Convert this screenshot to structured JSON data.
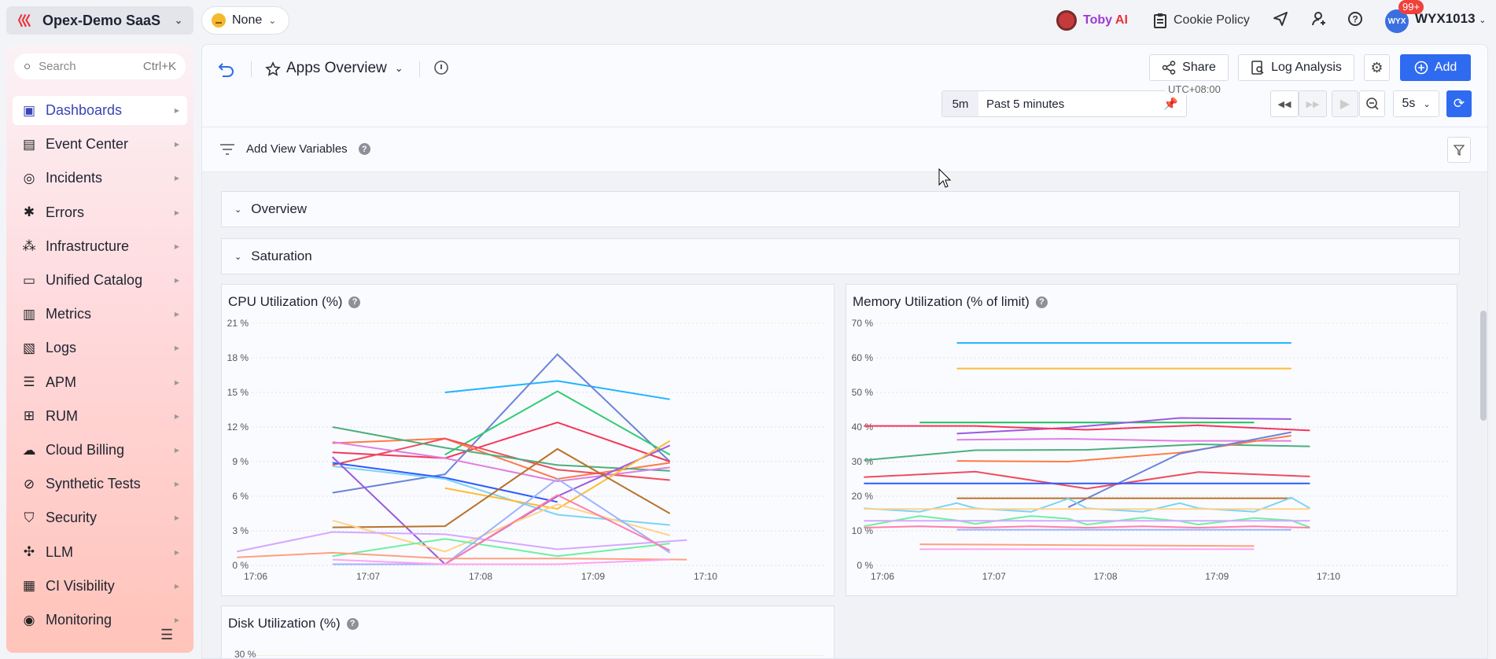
{
  "topbar": {
    "org": "Opex-Demo SaaS",
    "mood": "None",
    "toby_first": "Toby",
    "toby_second": "AI",
    "cookie": "Cookie Policy",
    "avatar": "WYX",
    "badge": "99+",
    "user": "WYX1013"
  },
  "sidebar": {
    "search_placeholder": "Search",
    "search_shortcut": "Ctrl+K",
    "items": [
      {
        "label": "Dashboards",
        "icon": "dashboard-icon"
      },
      {
        "label": "Event Center",
        "icon": "calendar-icon"
      },
      {
        "label": "Incidents",
        "icon": "incident-icon"
      },
      {
        "label": "Errors",
        "icon": "bug-icon"
      },
      {
        "label": "Infrastructure",
        "icon": "infrastructure-icon"
      },
      {
        "label": "Unified Catalog",
        "icon": "catalog-icon"
      },
      {
        "label": "Metrics",
        "icon": "metrics-icon"
      },
      {
        "label": "Logs",
        "icon": "logs-icon"
      },
      {
        "label": "APM",
        "icon": "apm-icon"
      },
      {
        "label": "RUM",
        "icon": "rum-icon"
      },
      {
        "label": "Cloud Billing",
        "icon": "cloud-billing-icon"
      },
      {
        "label": "Synthetic Tests",
        "icon": "synthetic-icon"
      },
      {
        "label": "Security",
        "icon": "shield-icon"
      },
      {
        "label": "LLM",
        "icon": "llm-icon"
      },
      {
        "label": "CI Visibility",
        "icon": "ci-icon"
      },
      {
        "label": "Monitoring",
        "icon": "monitoring-icon"
      }
    ]
  },
  "header": {
    "title": "Apps Overview",
    "share": "Share",
    "log_analysis": "Log Analysis",
    "add": "Add",
    "timezone": "UTC+08:00",
    "range_short": "5m",
    "range_label": "Past 5 minutes",
    "refresh_interval": "5s",
    "add_variables": "Add View Variables"
  },
  "sections": [
    "Overview",
    "Saturation"
  ],
  "colors": {
    "accent": "#2f6bf0",
    "active_nav": "#3a44b5"
  },
  "chart_data": [
    {
      "type": "line",
      "title": "CPU Utilization (%)",
      "yticks": [
        "0 %",
        "3 %",
        "6 %",
        "9 %",
        "12 %",
        "15 %",
        "18 %",
        "21 %"
      ],
      "ylim": [
        0,
        21
      ],
      "xticks": [
        "17:06",
        "17:07",
        "17:08",
        "17:09",
        "17:10"
      ],
      "xlim": [
        "17:06",
        "17:10"
      ],
      "grid": true,
      "series": [
        {
          "color": "#1eb4ff",
          "points": [
            [
              "17:07:41",
              15.0
            ],
            [
              "17:08:41",
              16.0
            ],
            [
              "17:09:41",
              14.4
            ]
          ]
        },
        {
          "color": "#6b84d9",
          "points": [
            [
              "17:06:41",
              6.3
            ],
            [
              "17:07:41",
              7.9
            ],
            [
              "17:08:41",
              18.3
            ],
            [
              "17:09:41",
              9.0
            ]
          ]
        },
        {
          "color": "#2ecc71",
          "points": [
            [
              "17:07:41",
              9.6
            ],
            [
              "17:08:41",
              15.1
            ],
            [
              "17:09:41",
              9.6
            ]
          ]
        },
        {
          "color": "#f5365c",
          "points": [
            [
              "17:06:41",
              9.8
            ],
            [
              "17:07:41",
              9.3
            ],
            [
              "17:08:41",
              12.4
            ],
            [
              "17:09:41",
              9.0
            ]
          ]
        },
        {
          "color": "#ff7a45",
          "points": [
            [
              "17:06:41",
              10.6
            ],
            [
              "17:07:41",
              11.0
            ],
            [
              "17:08:41",
              7.5
            ],
            [
              "17:09:41",
              8.9
            ]
          ]
        },
        {
          "color": "#ef4d5a",
          "points": [
            [
              "17:06:41",
              8.7
            ],
            [
              "17:07:41",
              11.0
            ],
            [
              "17:08:41",
              8.3
            ],
            [
              "17:09:41",
              7.4
            ]
          ]
        },
        {
          "color": "#4caf7d",
          "points": [
            [
              "17:06:41",
              12.0
            ],
            [
              "17:07:41",
              10.2
            ],
            [
              "17:08:41",
              8.7
            ],
            [
              "17:09:41",
              8.2
            ]
          ]
        },
        {
          "color": "#e07ee0",
          "points": [
            [
              "17:06:41",
              10.7
            ],
            [
              "17:07:41",
              9.3
            ],
            [
              "17:08:41",
              7.3
            ],
            [
              "17:09:41",
              8.5
            ]
          ]
        },
        {
          "color": "#2d5bff",
          "points": [
            [
              "17:06:41",
              8.9
            ],
            [
              "17:07:41",
              7.6
            ],
            [
              "17:08:41",
              5.5
            ]
          ]
        },
        {
          "color": "#7dd3f5",
          "points": [
            [
              "17:06:41",
              8.6
            ],
            [
              "17:07:41",
              7.5
            ],
            [
              "17:08:41",
              4.4
            ],
            [
              "17:09:41",
              3.5
            ]
          ]
        },
        {
          "color": "#9b59e0",
          "points": [
            [
              "17:06:41",
              9.4
            ],
            [
              "17:07:41",
              0.1
            ],
            [
              "17:08:41",
              6.0
            ],
            [
              "17:09:41",
              10.4
            ]
          ]
        },
        {
          "color": "#ffbb33",
          "points": [
            [
              "17:07:41",
              6.7
            ],
            [
              "17:08:41",
              4.9
            ],
            [
              "17:09:41",
              10.8
            ]
          ]
        },
        {
          "color": "#b8732a",
          "points": [
            [
              "17:06:41",
              3.3
            ],
            [
              "17:07:41",
              3.4
            ],
            [
              "17:08:41",
              10.1
            ],
            [
              "17:09:41",
              4.5
            ]
          ]
        },
        {
          "color": "#ffd38a",
          "points": [
            [
              "17:06:41",
              3.9
            ],
            [
              "17:07:41",
              1.2
            ],
            [
              "17:08:41",
              5.3
            ],
            [
              "17:09:41",
              2.6
            ]
          ]
        },
        {
          "color": "#d4a8ff",
          "points": [
            [
              "17:05:50",
              1.2
            ],
            [
              "17:06:41",
              2.9
            ],
            [
              "17:07:41",
              2.7
            ],
            [
              "17:08:41",
              1.4
            ],
            [
              "17:09:50",
              2.2
            ]
          ]
        },
        {
          "color": "#6ef0a0",
          "points": [
            [
              "17:06:41",
              0.8
            ],
            [
              "17:07:41",
              2.3
            ],
            [
              "17:08:41",
              0.8
            ],
            [
              "17:09:41",
              1.9
            ]
          ]
        },
        {
          "color": "#ff9f80",
          "points": [
            [
              "17:05:50",
              0.7
            ],
            [
              "17:06:41",
              1.1
            ],
            [
              "17:07:41",
              0.6
            ],
            [
              "17:08:41",
              0.6
            ],
            [
              "17:09:50",
              0.5
            ]
          ]
        },
        {
          "color": "#9fb3ff",
          "points": [
            [
              "17:06:41",
              0.1
            ],
            [
              "17:07:41",
              0.1
            ],
            [
              "17:08:41",
              7.5
            ],
            [
              "17:09:41",
              1.1
            ]
          ]
        },
        {
          "color": "#ff7fa8",
          "points": [
            [
              "17:07:41",
              0.1
            ],
            [
              "17:08:41",
              6.1
            ],
            [
              "17:09:41",
              1.3
            ]
          ]
        },
        {
          "color": "#ffa3f0",
          "points": [
            [
              "17:06:41",
              0.5
            ],
            [
              "17:07:41",
              0.1
            ],
            [
              "17:08:41",
              0.1
            ],
            [
              "17:09:41",
              0.5
            ]
          ]
        }
      ]
    },
    {
      "type": "line",
      "title": "Memory Utilization (% of limit)",
      "yticks": [
        "0 %",
        "10 %",
        "20 %",
        "30 %",
        "40 %",
        "50 %",
        "60 %",
        "70 %"
      ],
      "ylim": [
        0,
        70
      ],
      "xticks": [
        "17:06",
        "17:07",
        "17:08",
        "17:09",
        "17:10"
      ],
      "xlim": [
        "17:06",
        "17:10"
      ],
      "grid": true,
      "series": [
        {
          "color": "#1eb4ff",
          "points": [
            [
              "17:06:40",
              64.3
            ],
            [
              "17:09:40",
              64.3
            ]
          ]
        },
        {
          "color": "#ffbb33",
          "points": [
            [
              "17:06:40",
              56.9
            ],
            [
              "17:09:40",
              56.9
            ]
          ]
        },
        {
          "color": "#1fbf5f",
          "points": [
            [
              "17:06:20",
              41.3
            ],
            [
              "17:09:20",
              41.3
            ]
          ]
        },
        {
          "color": "#9b59e0",
          "points": [
            [
              "17:06:40",
              38.1
            ],
            [
              "17:07:40",
              39.8
            ],
            [
              "17:08:40",
              42.6
            ],
            [
              "17:09:40",
              42.3
            ]
          ]
        },
        {
          "color": "#f5365c",
          "points": [
            [
              "17:05:50",
              40.3
            ],
            [
              "17:06:50",
              40.3
            ],
            [
              "17:07:50",
              39.2
            ],
            [
              "17:08:50",
              40.5
            ],
            [
              "17:09:50",
              39.0
            ]
          ]
        },
        {
          "color": "#e07ee0",
          "points": [
            [
              "17:06:40",
              36.3
            ],
            [
              "17:07:40",
              36.6
            ],
            [
              "17:08:40",
              36.0
            ],
            [
              "17:09:40",
              36.0
            ]
          ]
        },
        {
          "color": "#4caf7d",
          "points": [
            [
              "17:05:50",
              30.4
            ],
            [
              "17:06:50",
              33.3
            ],
            [
              "17:07:50",
              33.4
            ],
            [
              "17:08:50",
              35.0
            ],
            [
              "17:09:50",
              34.4
            ]
          ]
        },
        {
          "color": "#ff7a45",
          "points": [
            [
              "17:06:40",
              30.2
            ],
            [
              "17:07:40",
              30.0
            ],
            [
              "17:08:40",
              32.6
            ],
            [
              "17:09:40",
              37.5
            ]
          ]
        },
        {
          "color": "#6b84d9",
          "points": [
            [
              "17:07:40",
              16.8
            ],
            [
              "17:08:40",
              32.3
            ],
            [
              "17:09:40",
              38.5
            ]
          ]
        },
        {
          "color": "#ef4d5a",
          "points": [
            [
              "17:05:50",
              25.5
            ],
            [
              "17:06:50",
              27.1
            ],
            [
              "17:07:50",
              22.2
            ],
            [
              "17:08:50",
              27.0
            ],
            [
              "17:09:50",
              25.7
            ]
          ]
        },
        {
          "color": "#2d5bff",
          "points": [
            [
              "17:05:50",
              23.7
            ],
            [
              "17:09:50",
              23.7
            ]
          ]
        },
        {
          "color": "#b8732a",
          "points": [
            [
              "17:06:40",
              19.4
            ],
            [
              "17:09:40",
              19.4
            ]
          ]
        },
        {
          "color": "#7dd3f5",
          "points": [
            [
              "17:05:50",
              16.5
            ],
            [
              "17:06:20",
              15.5
            ],
            [
              "17:06:40",
              18.0
            ],
            [
              "17:06:50",
              16.5
            ],
            [
              "17:07:20",
              15.5
            ],
            [
              "17:07:40",
              19.3
            ],
            [
              "17:07:50",
              16.5
            ],
            [
              "17:08:20",
              15.5
            ],
            [
              "17:08:40",
              18.0
            ],
            [
              "17:08:50",
              16.5
            ],
            [
              "17:09:20",
              15.5
            ],
            [
              "17:09:40",
              19.6
            ],
            [
              "17:09:50",
              16.5
            ]
          ]
        },
        {
          "color": "#ffd38a",
          "points": [
            [
              "17:05:50",
              16.3
            ],
            [
              "17:09:50",
              16.3
            ]
          ]
        },
        {
          "color": "#6ef0a0",
          "points": [
            [
              "17:05:50",
              11.3
            ],
            [
              "17:06:20",
              14.3
            ],
            [
              "17:06:40",
              13.0
            ],
            [
              "17:06:50",
              12.0
            ],
            [
              "17:07:20",
              14.3
            ],
            [
              "17:07:40",
              13.5
            ],
            [
              "17:07:50",
              11.8
            ],
            [
              "17:08:20",
              13.8
            ],
            [
              "17:08:40",
              12.8
            ],
            [
              "17:08:50",
              11.8
            ],
            [
              "17:09:20",
              13.7
            ],
            [
              "17:09:40",
              13.0
            ],
            [
              "17:09:50",
              11.0
            ]
          ]
        },
        {
          "color": "#d4a8ff",
          "points": [
            [
              "17:05:50",
              12.9
            ],
            [
              "17:09:50",
              12.9
            ]
          ]
        },
        {
          "color": "#ff7fa8",
          "points": [
            [
              "17:05:50",
              10.9
            ],
            [
              "17:06:20",
              11.3
            ],
            [
              "17:06:50",
              10.9
            ],
            [
              "17:07:20",
              11.3
            ],
            [
              "17:07:50",
              10.9
            ],
            [
              "17:08:20",
              11.3
            ],
            [
              "17:08:50",
              10.9
            ],
            [
              "17:09:20",
              11.3
            ],
            [
              "17:09:50",
              10.9
            ]
          ]
        },
        {
          "color": "#9fb3ff",
          "points": [
            [
              "17:06:40",
              10.3
            ],
            [
              "17:09:40",
              10.3
            ]
          ]
        },
        {
          "color": "#ff9f80",
          "points": [
            [
              "17:06:20",
              6.1
            ],
            [
              "17:09:20",
              5.6
            ]
          ]
        },
        {
          "color": "#ffa3f0",
          "points": [
            [
              "17:06:20",
              4.7
            ],
            [
              "17:09:20",
              4.7
            ]
          ]
        }
      ]
    },
    {
      "type": "line",
      "title": "Disk Utilization (%)",
      "yticks": [
        "30 %"
      ],
      "series": []
    }
  ]
}
